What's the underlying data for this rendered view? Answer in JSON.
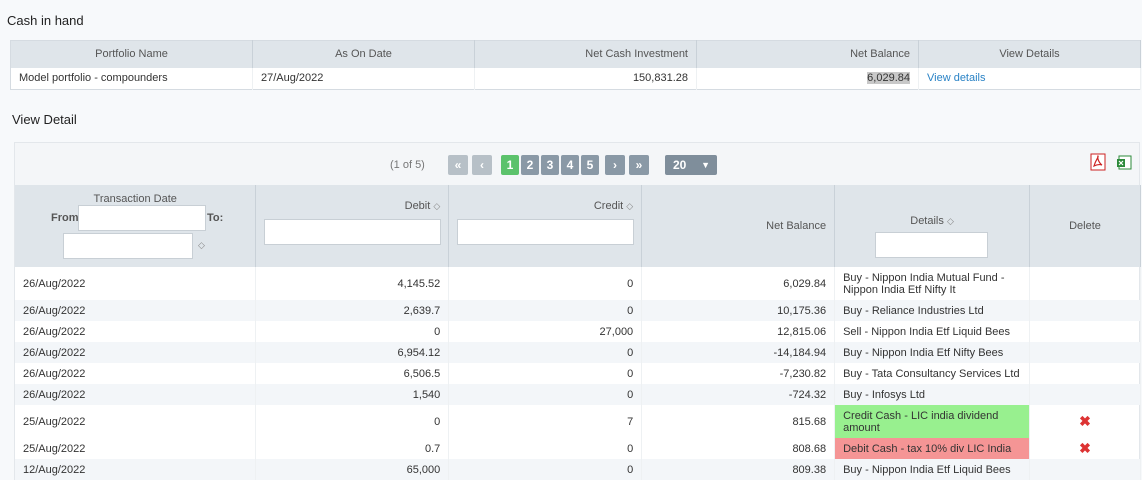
{
  "section1_title": "Cash in hand",
  "summary": {
    "headers": [
      "Portfolio Name",
      "As On Date",
      "Net Cash Investment",
      "Net Balance",
      "View Details"
    ],
    "row": {
      "name": "Model portfolio - compounders",
      "date": "27/Aug/2022",
      "net_cash": "150,831.28",
      "net_balance": "6,029.84",
      "view": "View details"
    }
  },
  "section2_title": "View Detail",
  "pager": {
    "info": "(1 of 5)",
    "first": "«",
    "prev": "‹",
    "pages": [
      "1",
      "2",
      "3",
      "4",
      "5"
    ],
    "next": "›",
    "last": "»",
    "page_size": "20",
    "current_page": "1"
  },
  "grid": {
    "headers": {
      "date": "Transaction Date",
      "from": "From:",
      "to": "To:",
      "debit": "Debit",
      "credit": "Credit",
      "net_balance": "Net Balance",
      "details": "Details",
      "delete": "Delete"
    },
    "rows": [
      {
        "date": "26/Aug/2022",
        "debit": "4,145.52",
        "credit": "0",
        "net": "6,029.84",
        "details": "Buy - Nippon India Mutual Fund - Nippon India Etf Nifty It"
      },
      {
        "date": "26/Aug/2022",
        "debit": "2,639.7",
        "credit": "0",
        "net": "10,175.36",
        "details": "Buy - Reliance Industries Ltd"
      },
      {
        "date": "26/Aug/2022",
        "debit": "0",
        "credit": "27,000",
        "net": "12,815.06",
        "details": "Sell - Nippon India Etf Liquid Bees"
      },
      {
        "date": "26/Aug/2022",
        "debit": "6,954.12",
        "credit": "0",
        "net": "-14,184.94",
        "details": "Buy - Nippon India Etf Nifty Bees"
      },
      {
        "date": "26/Aug/2022",
        "debit": "6,506.5",
        "credit": "0",
        "net": "-7,230.82",
        "details": "Buy - Tata Consultancy Services Ltd"
      },
      {
        "date": "26/Aug/2022",
        "debit": "1,540",
        "credit": "0",
        "net": "-724.32",
        "details": "Buy - Infosys Ltd"
      },
      {
        "date": "25/Aug/2022",
        "debit": "0",
        "credit": "7",
        "net": "815.68",
        "details": "Credit Cash - LIC india dividend amount"
      },
      {
        "date": "25/Aug/2022",
        "debit": "0.7",
        "credit": "0",
        "net": "808.68",
        "details": "Debit Cash - tax 10% div LIC India"
      },
      {
        "date": "12/Aug/2022",
        "debit": "65,000",
        "credit": "0",
        "net": "809.38",
        "details": "Buy - Nippon India Etf Liquid Bees"
      }
    ],
    "delete_icon": "✖"
  },
  "colors": {
    "credit_row": "#98f08f",
    "debit_row": "#f59595",
    "pager_current": "#5bc26b"
  }
}
